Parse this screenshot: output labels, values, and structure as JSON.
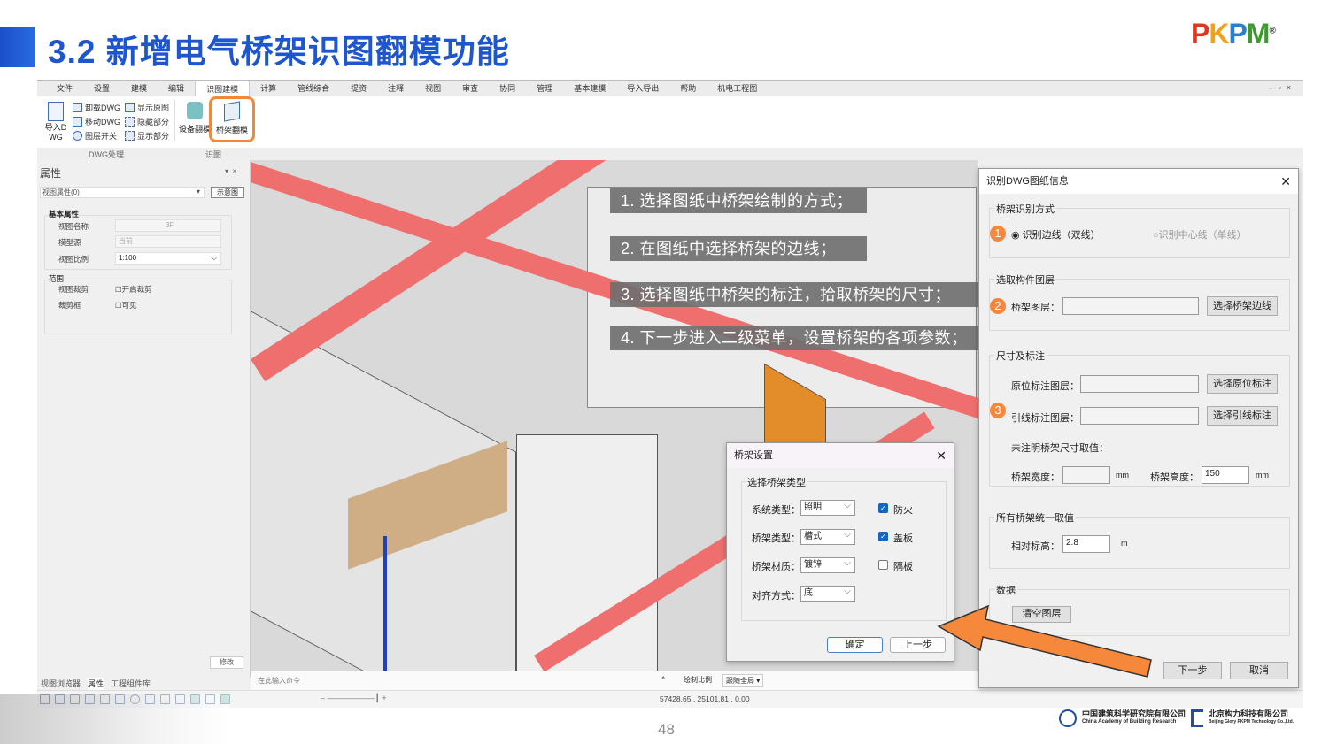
{
  "slide": {
    "title": "3.2 新增电气桥架识图翻模功能",
    "page_number": "48",
    "logo": "PKPM",
    "org1_cn": "中国建筑科学研究院有限公司",
    "org1_en": "China Academy of Building Research",
    "org2_cn": "北京构力科技有限公司",
    "org2_en": "Beijing Glory PKPM Technology Co.,Ltd."
  },
  "menu": [
    "文件",
    "设置",
    "建模",
    "编辑",
    "识图建模",
    "计算",
    "管线综合",
    "提资",
    "注释",
    "视图",
    "审查",
    "协同",
    "管理",
    "基本建模",
    "导入导出",
    "帮助",
    "机电工程图"
  ],
  "menu_active": "识图建模",
  "ribbon": {
    "import_dwg": "导入DWG",
    "unload_dwg": "卸载DWG",
    "move_dwg": "移动DWG",
    "layer_switch": "图层开关",
    "show_original": "显示原图",
    "hide_part": "隐藏部分",
    "show_part": "显示部分",
    "equipment_model": "设备翻模",
    "tray_model": "桥架翻模",
    "group_dwg": "DWG处理",
    "group_recognize": "识图"
  },
  "properties": {
    "title": "属性",
    "selector": "视图属性(0)",
    "diagram_btn": "示意图",
    "basic_group": "基本属性",
    "view_name_label": "视图名称",
    "view_name": "3F",
    "model_source_label": "模型源",
    "model_source": "当前",
    "scale_label": "视图比例",
    "scale": "1:100",
    "range_group": "范围",
    "crop_label": "视图裁剪",
    "crop_check": "开启裁剪",
    "crop_box_label": "裁剪框",
    "crop_box_check": "可见",
    "modify_btn": "修改"
  },
  "bottom_tabs": [
    "视图浏览器",
    "属性",
    "工程组件库"
  ],
  "command": {
    "placeholder": "在此输入命令",
    "scale_label": "绘制比例",
    "scale_value": "跟随全局"
  },
  "coords": "57428.65 , 25101.81 , 0.00",
  "steps": [
    "1. 选择图纸中桥架绘制的方式；",
    "2. 在图纸中选择桥架的边线；",
    "3. 选择图纸中桥架的标注，拾取桥架的尺寸；",
    "4. 下一步进入二级菜单，设置桥架的各项参数；"
  ],
  "tray_settings": {
    "title": "桥架设置",
    "group": "选择桥架类型",
    "system_label": "系统类型：",
    "system": "照明",
    "type_label": "桥架类型：",
    "type": "槽式",
    "material_label": "桥架材质：",
    "material": "镀锌",
    "align_label": "对齐方式：",
    "align": "底",
    "fireproof": "防火",
    "cover": "盖板",
    "partition": "隔板",
    "ok": "确定",
    "prev": "上一步"
  },
  "recognize_dialog": {
    "title": "识别DWG图纸信息",
    "method_group": "桥架识别方式",
    "opt_edge": "识别边线（双线）",
    "opt_center": "识别中心线（单线）",
    "layer_group": "选取构件图层",
    "tray_layer_label": "桥架图层：",
    "select_edge_btn": "选择桥架边线",
    "dim_group": "尺寸及标注",
    "origin_label": "原位标注图层：",
    "select_origin_btn": "选择原位标注",
    "leader_label": "引线标注图层：",
    "select_leader_btn": "选择引线标注",
    "unmarked_label": "未注明桥架尺寸取值：",
    "width_label": "桥架宽度：",
    "width": "",
    "height_label": "桥架高度：",
    "height": "150",
    "unit_mm": "mm",
    "uniform_group": "所有桥架统一取值",
    "elev_label": "相对标高：",
    "elev": "2.8",
    "unit_m": "m",
    "data_group": "数据",
    "clear_btn": "清空图层",
    "next": "下一步",
    "cancel": "取消",
    "badges": [
      "1",
      "2",
      "3"
    ]
  }
}
